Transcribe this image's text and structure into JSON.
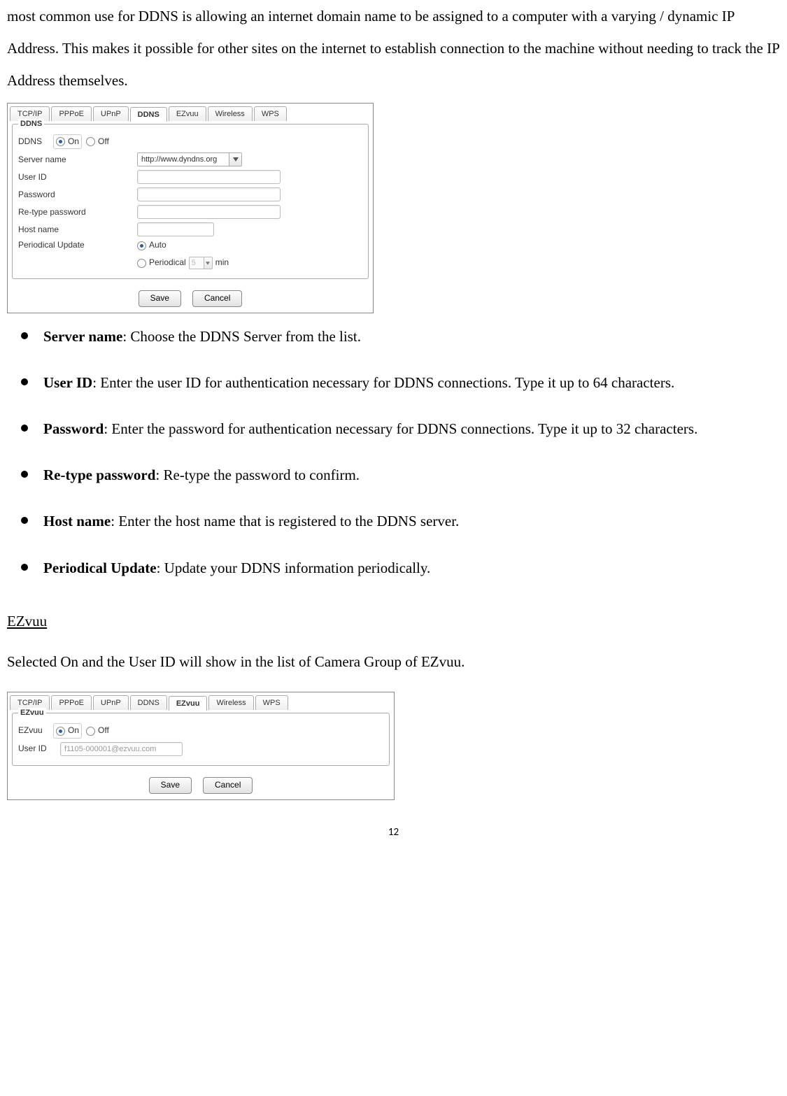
{
  "intro": "most common use for DDNS is allowing an internet domain name to be assigned to a computer with a varying / dynamic IP Address. This makes it possible for other sites on the internet to establish connection to the machine without needing to track the IP Address themselves.",
  "ddns_panel": {
    "tabs": [
      "TCP/IP",
      "PPPoE",
      "UPnP",
      "DDNS",
      "EZvuu",
      "Wireless",
      "WPS"
    ],
    "active_tab": "DDNS",
    "legend": "DDNS",
    "labels": {
      "ddns": "DDNS",
      "on": "On",
      "off": "Off",
      "server_name": "Server name",
      "user_id": "User ID",
      "password": "Password",
      "retype_password": "Re-type password",
      "host_name": "Host name",
      "periodical_update": "Periodical Update",
      "auto": "Auto",
      "periodical": "Periodical",
      "periodical_value": "5",
      "min": "min"
    },
    "server_value": "http://www.dyndns.org",
    "buttons": {
      "save": "Save",
      "cancel": "Cancel"
    }
  },
  "bullets": [
    {
      "term": "Server name",
      "text": ": Choose the DDNS Server from the list."
    },
    {
      "term": "User ID",
      "text": ": Enter the user ID for authentication necessary for DDNS connections. Type it up to 64 characters."
    },
    {
      "term": "Password",
      "text": ": Enter the password for authentication necessary for DDNS connections. Type it up to 32 characters."
    },
    {
      "term": "Re-type password",
      "text": ": Re-type the password to confirm."
    },
    {
      "term": "Host name",
      "text": ": Enter the host name that is registered to the DDNS server."
    },
    {
      "term": "Periodical Update",
      "text": ": Update your DDNS information periodically."
    }
  ],
  "ezvuu_section": {
    "title": "EZvuu",
    "description": "Selected On and the User ID will show in the list of Camera Group of EZvuu."
  },
  "ezvuu_panel": {
    "tabs": [
      "TCP/IP",
      "PPPoE",
      "UPnP",
      "DDNS",
      "EZvuu",
      "Wireless",
      "WPS"
    ],
    "active_tab": "EZvuu",
    "legend": "EZvuu",
    "labels": {
      "ezvuu": "EZvuu",
      "on": "On",
      "off": "Off",
      "user_id": "User ID"
    },
    "user_id_value": "f1105-000001@ezvuu.com",
    "buttons": {
      "save": "Save",
      "cancel": "Cancel"
    }
  },
  "page_number": "12"
}
